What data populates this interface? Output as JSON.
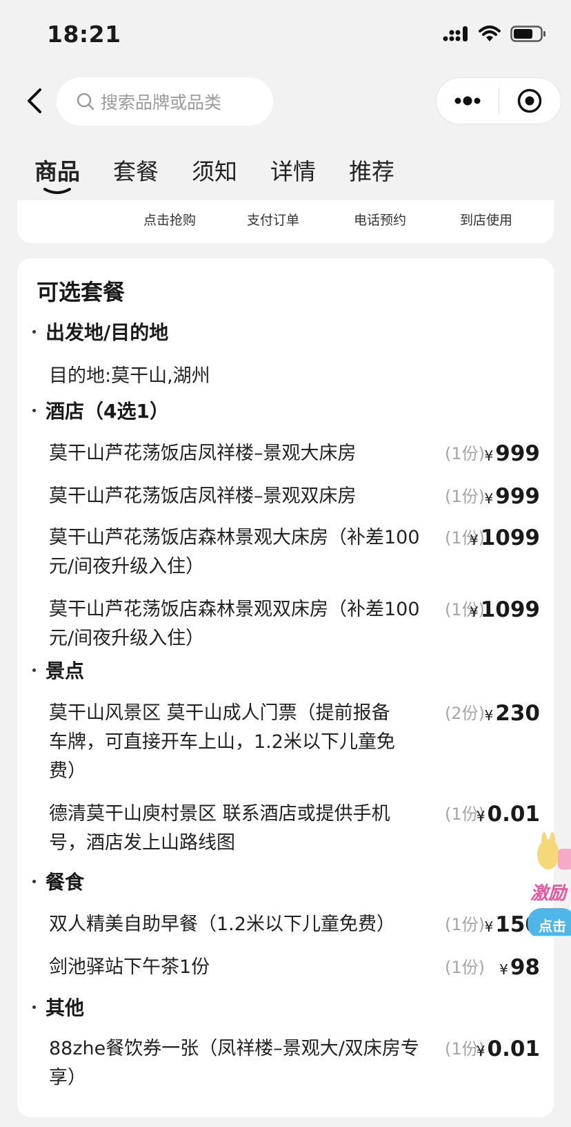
{
  "status_bar": {
    "time": "18:21"
  },
  "search": {
    "placeholder": "搜索品牌或品类"
  },
  "tabs": [
    {
      "label": "商品",
      "active": true
    },
    {
      "label": "套餐",
      "active": false
    },
    {
      "label": "须知",
      "active": false
    },
    {
      "label": "详情",
      "active": false
    },
    {
      "label": "推荐",
      "active": false
    }
  ],
  "steps": [
    "点击抢购",
    "支付订单",
    "电话预约",
    "到店使用"
  ],
  "package": {
    "title": "可选套餐",
    "sections": {
      "origin": {
        "title": "出发地/目的地",
        "text": "目的地:莫干山,湖州"
      },
      "hotel": {
        "title": "酒店（4选1）",
        "items": [
          {
            "name": "莫干山芦花荡饭店凤祥楼–景观大床房",
            "qty": "(1份)",
            "currency": "¥",
            "price": "999"
          },
          {
            "name": "莫干山芦花荡饭店凤祥楼–景观双床房",
            "qty": "(1份)",
            "currency": "¥",
            "price": "999"
          },
          {
            "name": "莫干山芦花荡饭店森林景观大床房（补差100元/间夜升级入住）",
            "qty": "(1份)",
            "currency": "¥",
            "price": "1099"
          },
          {
            "name": "莫干山芦花荡饭店森林景观双床房（补差100元/间夜升级入住）",
            "qty": "(1份)",
            "currency": "¥",
            "price": "1099"
          }
        ]
      },
      "attraction": {
        "title": "景点",
        "items": [
          {
            "name": "莫干山风景区 莫干山成人门票（提前报备车牌，可直接开车上山，1.2米以下儿童免费）",
            "qty": "(2份)",
            "currency": "¥",
            "price": "230"
          },
          {
            "name": "德清莫干山庾村景区 联系酒店或提供手机号，酒店发上山路线图",
            "qty": "(1份)",
            "currency": "¥",
            "price": "0.01"
          }
        ]
      },
      "dining": {
        "title": "餐食",
        "items": [
          {
            "name": "双人精美自助早餐（1.2米以下儿童免费）",
            "qty": "(1份)",
            "currency": "¥",
            "price": "150"
          },
          {
            "name": "剑池驿站下午茶1份",
            "qty": "(1份)",
            "currency": "¥",
            "price": "98"
          }
        ]
      },
      "other": {
        "title": "其他",
        "items": [
          {
            "name": "88zhe餐饮券一张（凤祥楼–景观大/双床房专享）",
            "qty": "(1份)",
            "currency": "¥",
            "price": "0.01"
          }
        ]
      }
    }
  },
  "float_badge": {
    "text": "激励",
    "button": "点击"
  }
}
